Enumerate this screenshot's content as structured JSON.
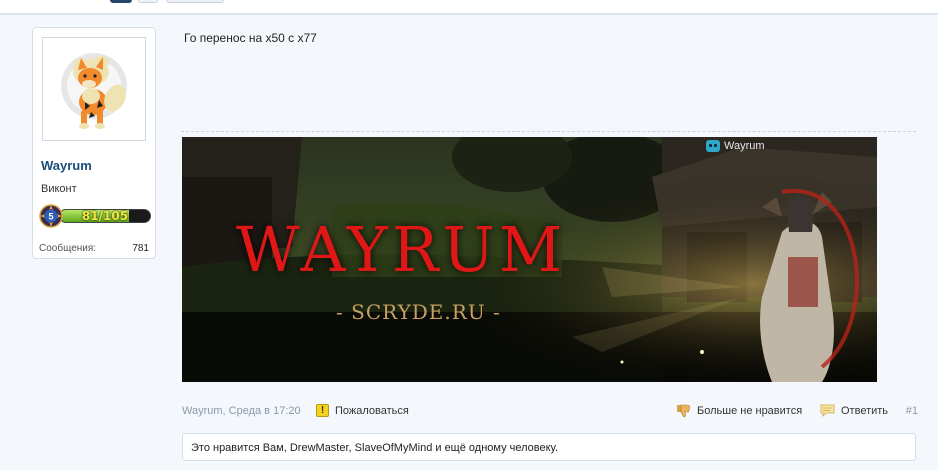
{
  "post": {
    "author": "Wayrum",
    "user_title": "Виконт",
    "rank": {
      "level": "5",
      "progress_text": "81/105",
      "progress_fraction": 0.77
    },
    "stats": {
      "label": "Сообщения:",
      "value": "781"
    },
    "message": "Го перенос на х50 с х77",
    "signature": {
      "title": "WAYRUM",
      "subtitle": "-  SCRYDE.RU  -",
      "tag": "Wayrum"
    },
    "footer": {
      "meta": "Wayrum, Среда в 17:20",
      "report": "Пожаловаться",
      "unlike": "Больше не нравится",
      "reply": "Ответить",
      "number": "#1"
    },
    "likes": {
      "prefix": "Это нравится Вам, ",
      "user1": "DrewMaster",
      "sep": ", ",
      "user2": "SlaveOfMyMind",
      "suffix": " и ещё одному человеку."
    }
  },
  "colors": {
    "accent": "#1d4d77",
    "background": "#f4f8fc",
    "banner_title": "#e01717",
    "rank_fill": "#5fa818"
  },
  "icons": [
    "avatar-arcanine",
    "rank-badge-icon",
    "warning-icon",
    "thumbs-down-icon",
    "speech-bubble-icon",
    "gamepad-icon"
  ]
}
